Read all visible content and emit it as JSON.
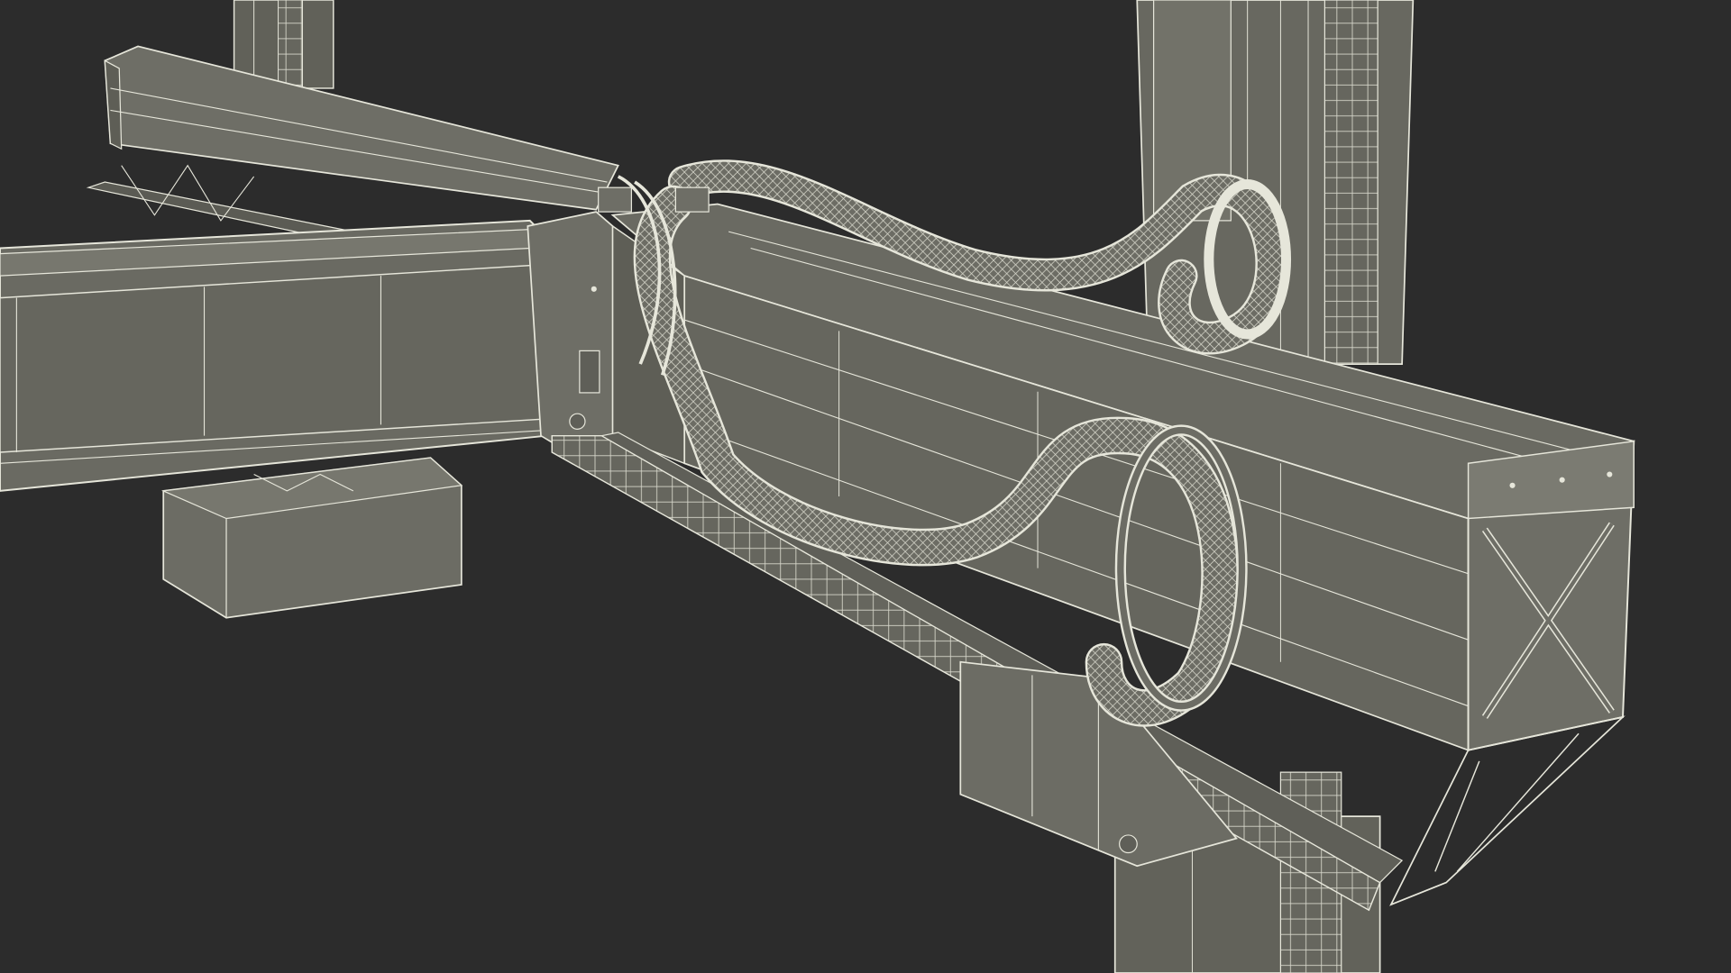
{
  "scene": {
    "background_color": "#2c2c2c",
    "model_fill": "#6c6c64",
    "model_fill_light": "#7b7b72",
    "model_fill_dark": "#55554f",
    "wire_color": "#e6e6da",
    "wire_color_dim": "#c9c9bd"
  }
}
